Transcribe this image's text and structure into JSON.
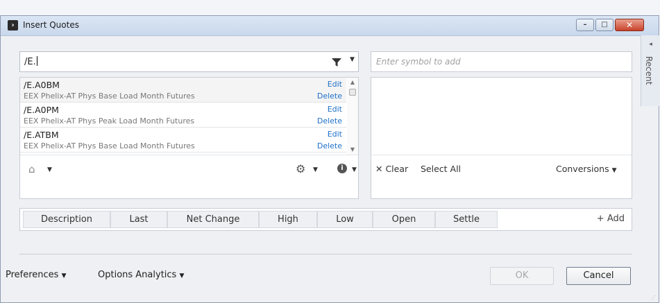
{
  "window": {
    "title": "Insert Quotes",
    "controls": {
      "minimize": "–",
      "maximize": "□",
      "close": "✕"
    }
  },
  "recent_tab": {
    "label": "Recent",
    "arrow": "◂"
  },
  "search": {
    "value": "/E."
  },
  "symbol_input": {
    "placeholder": "Enter symbol to add"
  },
  "results": [
    {
      "symbol": "/E.A0BM",
      "description": "EEX Phelix-AT Phys Base Load Month Futures",
      "edit": "Edit",
      "delete": "Delete"
    },
    {
      "symbol": "/E.A0PM",
      "description": "EEX Phelix-AT Phys Peak Load Month Futures",
      "edit": "Edit",
      "delete": "Delete"
    },
    {
      "symbol": "/E.ATBM",
      "description": "EEX Phelix-AT Phys Base Load Month Futures",
      "edit": "Edit",
      "delete": "Delete"
    }
  ],
  "basket_toolbar": {
    "clear": "✕ Clear",
    "select_all": "Select All",
    "conversions": "Conversions"
  },
  "fields": [
    {
      "label": "Description"
    },
    {
      "label": "Last"
    },
    {
      "label": "Net Change"
    },
    {
      "label": "High"
    },
    {
      "label": "Low"
    },
    {
      "label": "Open"
    },
    {
      "label": "Settle"
    }
  ],
  "add_field": "+ Add",
  "footer": {
    "preferences": "Preferences",
    "options_analytics": "Options Analytics",
    "ok": "OK",
    "cancel": "Cancel"
  },
  "icons": {
    "app": "chevron-right-icon",
    "filter": "filter-icon",
    "home": "home-icon",
    "gear": "gear-icon",
    "info": "info-icon",
    "dropdown": "caret-down-icon"
  },
  "colors": {
    "link": "#1d6fc8",
    "title_bar": "#c9d8ec",
    "close_button": "#c8412b"
  }
}
